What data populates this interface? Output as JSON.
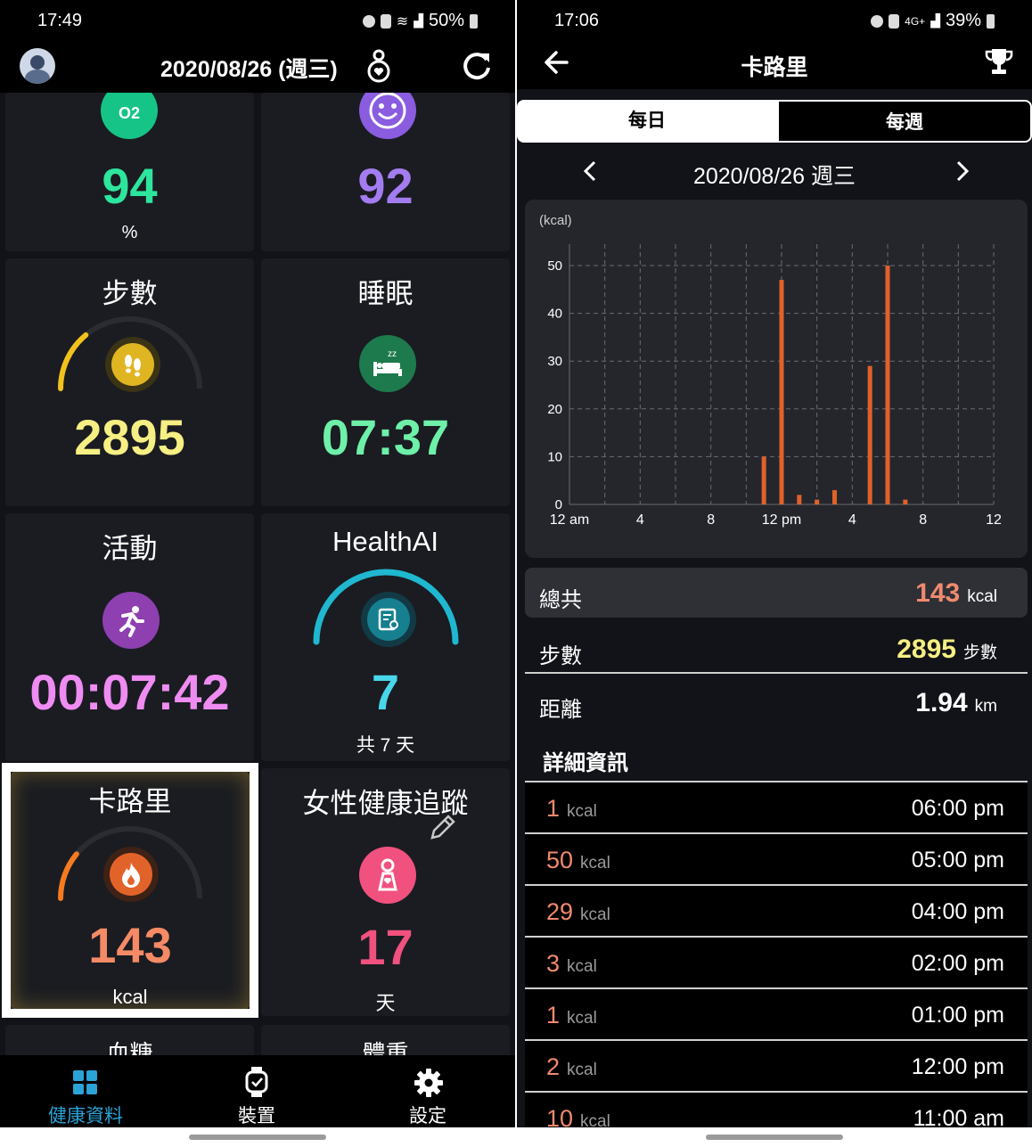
{
  "left": {
    "status": {
      "time": "17:49",
      "battery": "50%"
    },
    "header": {
      "date": "2020/08/26 (週三)"
    },
    "tiles": {
      "oxygen": {
        "icon_text": "O2",
        "value": "94",
        "unit": "%"
      },
      "mood": {
        "value": "92"
      },
      "steps": {
        "title": "步數",
        "value": "2895",
        "progress": 0.28
      },
      "sleep": {
        "title": "睡眠",
        "value": "07:37"
      },
      "activity": {
        "title": "活動",
        "value": "00:07:42"
      },
      "healthai": {
        "title": "HealthAI",
        "value": "7",
        "unit": "共 7 天"
      },
      "calories": {
        "title": "卡路里",
        "value": "143",
        "unit": "kcal",
        "progress": 0.22
      },
      "female": {
        "title": "女性健康追蹤",
        "value": "17",
        "unit": "天"
      },
      "glucose": {
        "title": "血糖"
      },
      "weight": {
        "title": "體重"
      }
    },
    "nav": [
      {
        "label": "健康資料"
      },
      {
        "label": "裝置"
      },
      {
        "label": "設定"
      }
    ]
  },
  "right": {
    "status": {
      "time": "17:06",
      "battery": "39%"
    },
    "header": {
      "title": "卡路里"
    },
    "tabs": {
      "daily": "每日",
      "weekly": "每週"
    },
    "date": "2020/08/26 週三",
    "summary": {
      "total": {
        "label": "總共",
        "value": "143",
        "unit": "kcal"
      },
      "steps": {
        "label": "步數",
        "value": "2895",
        "unit": "步數"
      },
      "distance": {
        "label": "距離",
        "value": "1.94",
        "unit": "km"
      }
    },
    "details": {
      "title": "詳細資訊",
      "rows": [
        {
          "value": "1",
          "unit": "kcal",
          "time": "06:00 pm"
        },
        {
          "value": "50",
          "unit": "kcal",
          "time": "05:00 pm"
        },
        {
          "value": "29",
          "unit": "kcal",
          "time": "04:00 pm"
        },
        {
          "value": "3",
          "unit": "kcal",
          "time": "02:00 pm"
        },
        {
          "value": "1",
          "unit": "kcal",
          "time": "01:00 pm"
        },
        {
          "value": "2",
          "unit": "kcal",
          "time": "12:00 pm"
        },
        {
          "value": "10",
          "unit": "kcal",
          "time": "11:00 am"
        }
      ]
    }
  },
  "colors": {
    "oxygen": "#2ee59d",
    "mood": "#a37cf0",
    "steps": "#f6ef83",
    "sleep": "#6ef0a9",
    "activity": "#ef8cf2",
    "healthai": "#49d6ea",
    "calories": "#f58a66",
    "female": "#f0517f",
    "bar": "#e0612a",
    "total_value": "#f08a6e",
    "steps_value": "#f6ef83"
  },
  "chart_data": {
    "type": "bar",
    "ylabel": "(kcal)",
    "ylim": [
      0,
      50
    ],
    "yticks": [
      0,
      10,
      20,
      30,
      40,
      50
    ],
    "xlim": [
      0,
      24
    ],
    "xticks": [
      {
        "v": 0,
        "label": "12 am"
      },
      {
        "v": 4,
        "label": "4"
      },
      {
        "v": 8,
        "label": "8"
      },
      {
        "v": 12,
        "label": "12 pm"
      },
      {
        "v": 16,
        "label": "4"
      },
      {
        "v": 20,
        "label": "8"
      },
      {
        "v": 24,
        "label": "12"
      }
    ],
    "grid": true,
    "series": [
      {
        "x": [
          11,
          12,
          13,
          14,
          15,
          17,
          18,
          19
        ],
        "values": [
          10,
          47,
          2,
          1,
          3,
          29,
          50,
          1
        ]
      }
    ]
  }
}
